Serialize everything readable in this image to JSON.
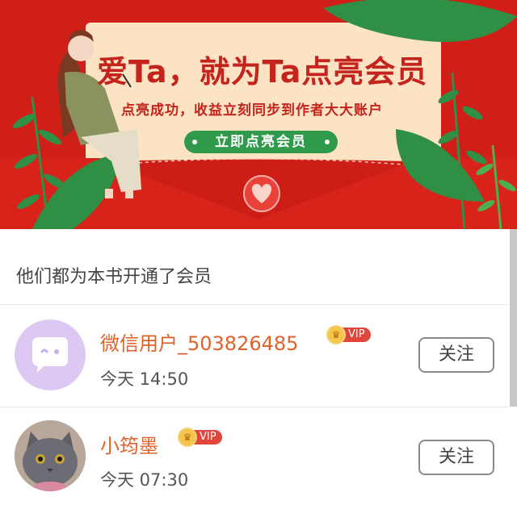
{
  "banner": {
    "title": "爱Ta，就为Ta点亮会员",
    "subtitle": "点亮成功，收益立刻同步到作者大大账户",
    "cta_label": "立即点亮会员",
    "colors": {
      "background": "#cf1f18",
      "card": "#fbe3c4",
      "button": "#2f9a4a"
    }
  },
  "section": {
    "title": "他们都为本书开通了会员"
  },
  "members": [
    {
      "name": "微信用户_503826485",
      "badge": "VIP",
      "time": "今天 14:50",
      "follow_label": "关注",
      "avatar": "wechat-default-avatar"
    },
    {
      "name": "小筠墨",
      "badge": "VIP",
      "time": "今天 07:30",
      "follow_label": "关注",
      "avatar": "cat-photo-avatar"
    }
  ]
}
